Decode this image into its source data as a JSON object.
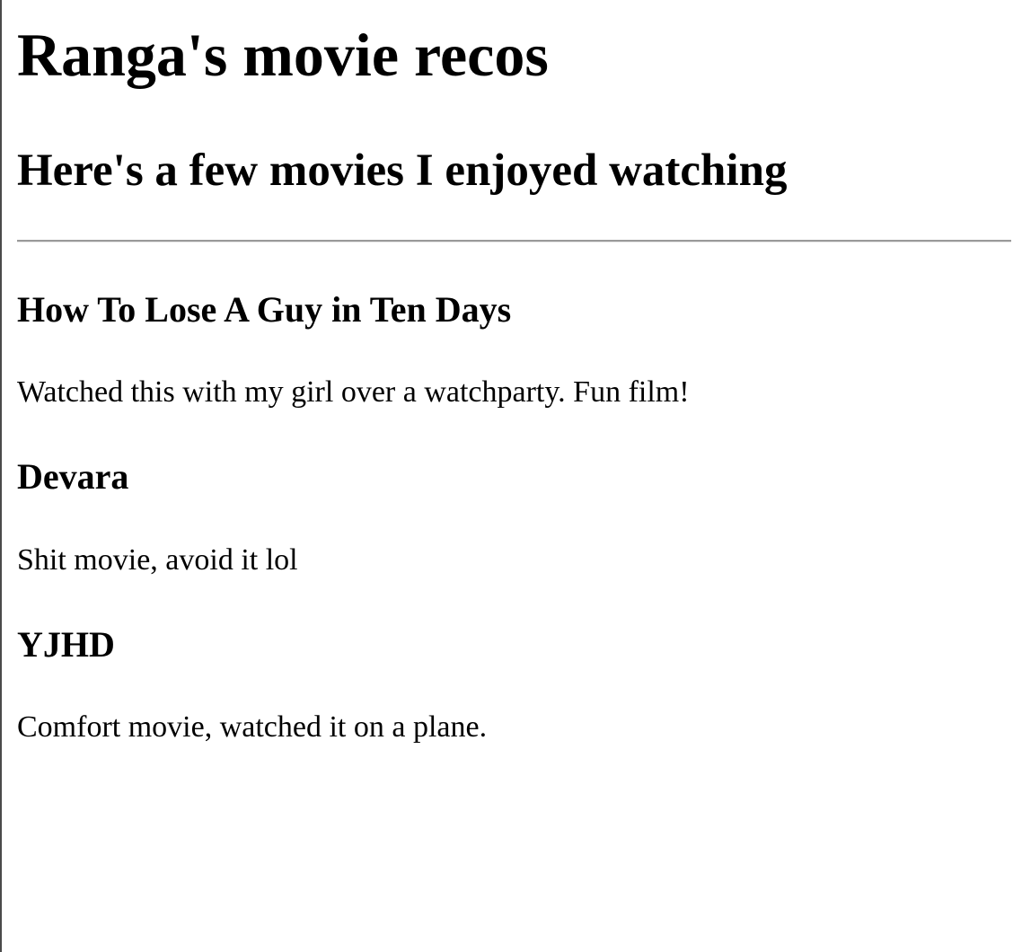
{
  "page": {
    "title": "Ranga's movie recos",
    "subtitle": "Here's a few movies I enjoyed watching"
  },
  "movies": [
    {
      "title": "How To Lose A Guy in Ten Days",
      "note": "Watched this with my girl over a watchparty. Fun film!"
    },
    {
      "title": "Devara",
      "note": "Shit movie, avoid it lol"
    },
    {
      "title": "YJHD",
      "note": "Comfort movie, watched it on a plane."
    }
  ]
}
